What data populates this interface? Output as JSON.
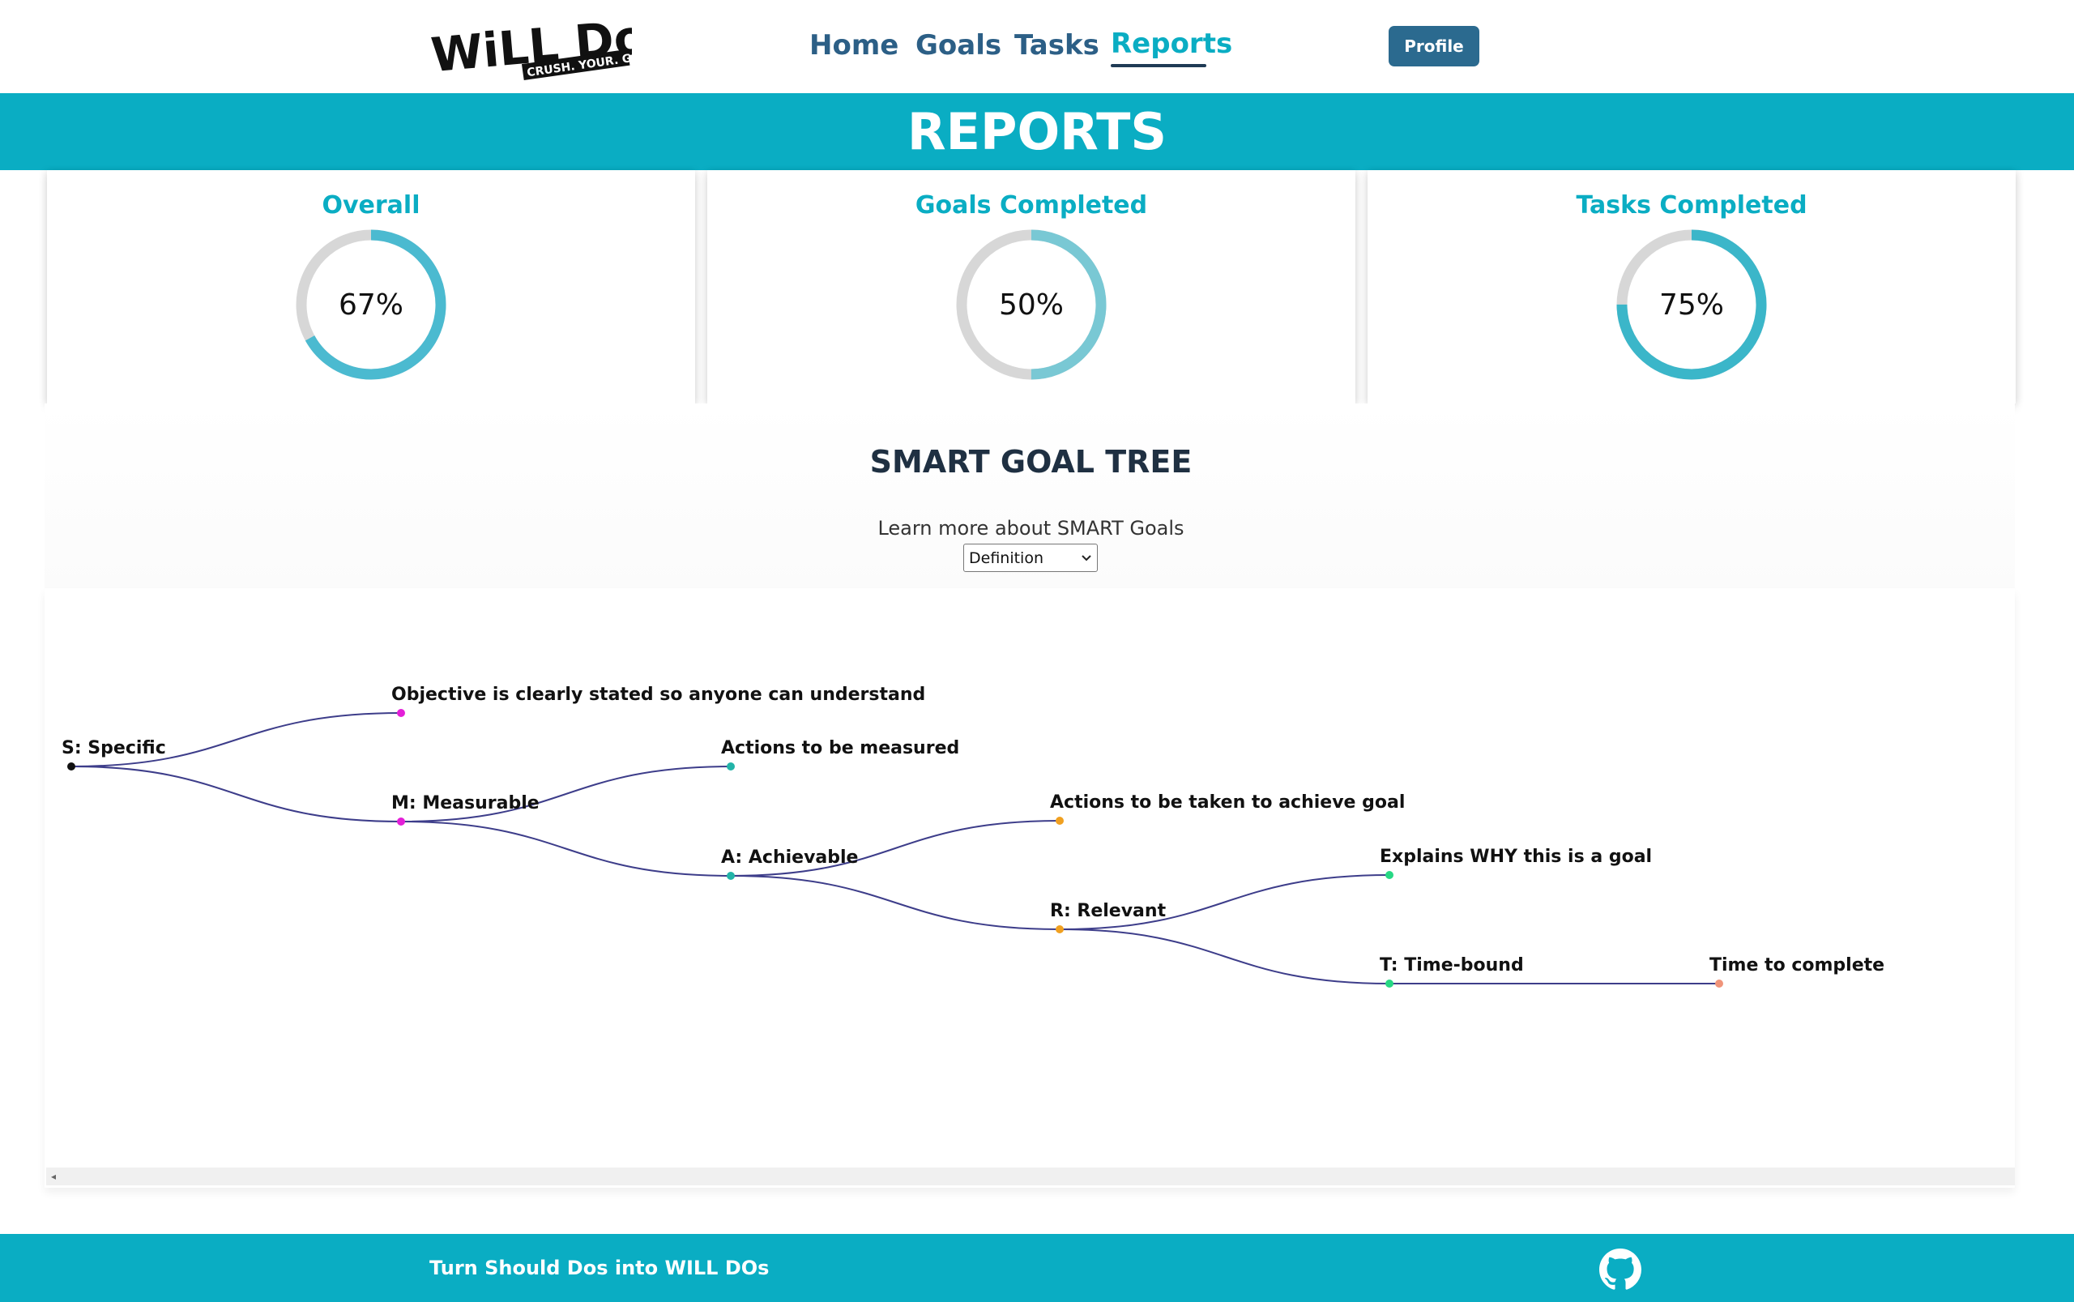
{
  "header": {
    "logo": {
      "word": "WiLL Do",
      "tagline": "CRUSH. YOUR. GOALS."
    },
    "nav": [
      {
        "label": "Home"
      },
      {
        "label": "Goals"
      },
      {
        "label": "Tasks"
      },
      {
        "label": "Reports",
        "active": true
      }
    ],
    "profile_label": "Profile"
  },
  "banner": {
    "title": "REPORTS"
  },
  "stats": [
    {
      "title": "Overall",
      "value_text": "67%",
      "percent": 67
    },
    {
      "title": "Goals Completed",
      "value_text": "50%",
      "percent": 50
    },
    {
      "title": "Tasks Completed",
      "value_text": "75%",
      "percent": 75
    }
  ],
  "smart": {
    "title": "SMART GOAL TREE",
    "subtitle": "Learn more about SMART Goals",
    "select_value": "Definition",
    "nodes": [
      {
        "label": "S: Specific",
        "color": "#111111"
      },
      {
        "label": "Objective is clearly stated so anyone can understand",
        "color": "#e31fd8"
      },
      {
        "label": "M: Measurable",
        "color": "#e31fd8"
      },
      {
        "label": "Actions to be measured",
        "color": "#22b3a8"
      },
      {
        "label": "A: Achievable",
        "color": "#22b3a8"
      },
      {
        "label": "Actions to be taken to achieve goal",
        "color": "#f0a020"
      },
      {
        "label": "R: Relevant",
        "color": "#f0a020"
      },
      {
        "label": "Explains WHY this is a goal",
        "color": "#27d884"
      },
      {
        "label": "T: Time-bound",
        "color": "#27d884"
      },
      {
        "label": "Time to complete",
        "color": "#f0947a"
      }
    ]
  },
  "colors": {
    "accent": "#0aadc3",
    "nav": "#2c5f86",
    "button": "#2b6a8f",
    "ring_track": "#d7d7d7",
    "link_line": "#3d3d8a"
  },
  "footer": {
    "tagline": "Turn Should Dos into WILL DOs"
  }
}
